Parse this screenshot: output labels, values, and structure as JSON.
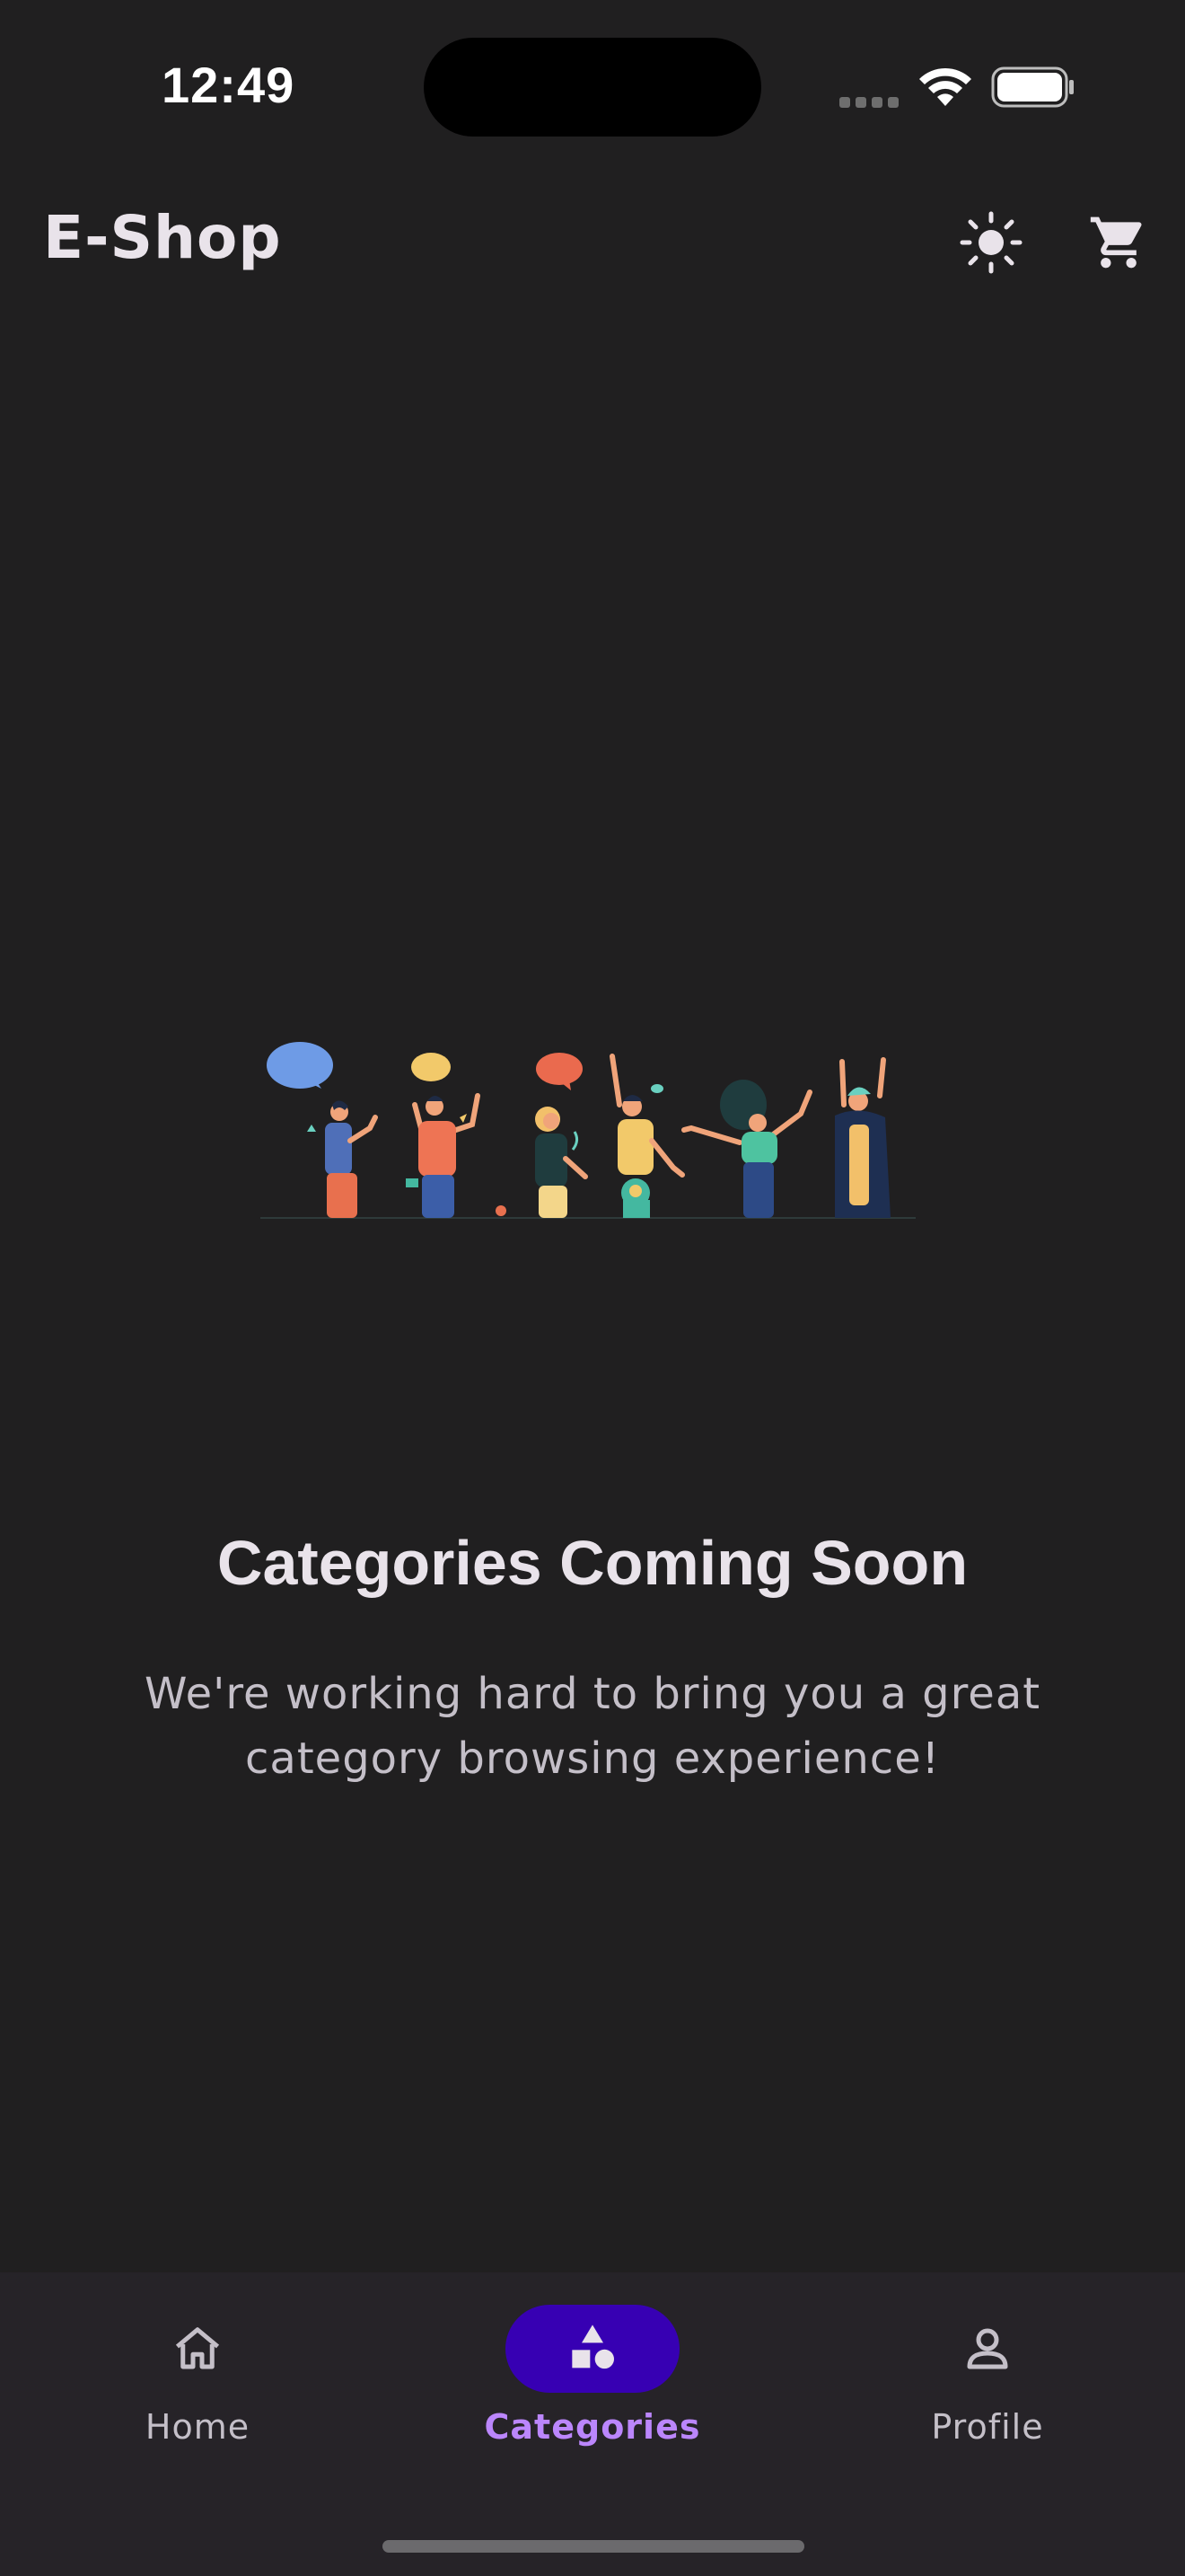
{
  "status_bar": {
    "time": "12:49",
    "icons": [
      "cellular-signal-icon",
      "wifi-icon",
      "battery-icon"
    ]
  },
  "app_bar": {
    "title": "E-Shop",
    "actions": [
      {
        "name": "theme-toggle",
        "icon": "sun-icon"
      },
      {
        "name": "cart",
        "icon": "cart-icon"
      }
    ]
  },
  "empty_state": {
    "illustration": "group-of-people-celebrating-illustration",
    "title": "Categories Coming Soon",
    "message": "We're working hard to bring you a great category browsing experience!"
  },
  "bottom_nav": {
    "items": [
      {
        "label": "Home",
        "icon": "home-icon",
        "selected": false
      },
      {
        "label": "Categories",
        "icon": "shapes-icon",
        "selected": true
      },
      {
        "label": "Profile",
        "icon": "person-icon",
        "selected": false
      }
    ]
  },
  "colors": {
    "background": "#201f20",
    "nav_background": "#262328",
    "accent": "#bb86fc",
    "selected_pill": "#3700b3",
    "text_primary": "#e9e3ea",
    "text_secondary": "#c4bfc8"
  }
}
